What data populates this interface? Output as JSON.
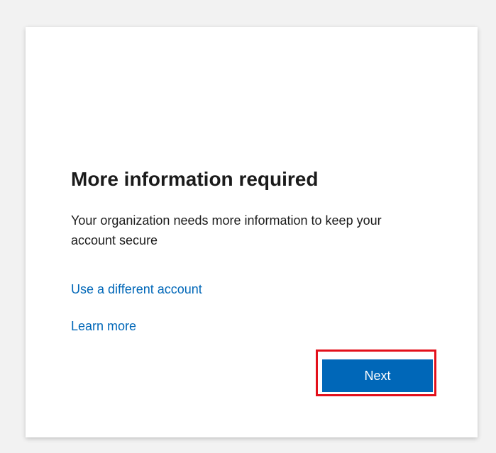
{
  "dialog": {
    "title": "More information required",
    "description": "Your organization needs more information to keep your account secure",
    "links": {
      "different_account": "Use a different account",
      "learn_more": "Learn more"
    },
    "next_label": "Next"
  },
  "colors": {
    "page_background": "#f2f2f2",
    "card_background": "#ffffff",
    "link": "#0067b8",
    "primary_button": "#0067b8",
    "highlight_border": "#e3101b",
    "text": "#1b1b1b"
  }
}
